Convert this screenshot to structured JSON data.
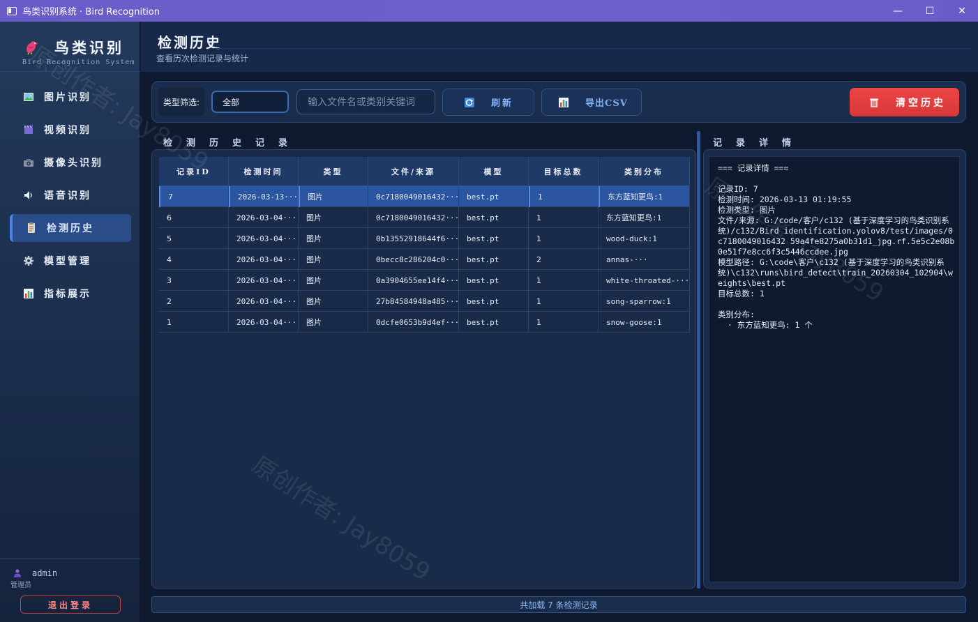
{
  "window": {
    "title": "鸟类识别系统 · Bird Recognition",
    "minimize": "—",
    "maximize": "☐",
    "close": "✕"
  },
  "sidebar": {
    "brand_title": "鸟类识别",
    "brand_subtitle": "Bird Recognition System",
    "items": [
      {
        "label": "图片识别",
        "icon": "image-icon"
      },
      {
        "label": "视频识别",
        "icon": "video-icon"
      },
      {
        "label": "摄像头识别",
        "icon": "camera-icon"
      },
      {
        "label": "语音识别",
        "icon": "speaker-icon"
      },
      {
        "label": "检测历史",
        "icon": "document-icon",
        "active": true
      },
      {
        "label": "模型管理",
        "icon": "gear-icon"
      },
      {
        "label": "指标展示",
        "icon": "chart-icon"
      }
    ],
    "user_name": "admin",
    "user_role": "管理员",
    "logout": "退出登录"
  },
  "header": {
    "title": "检测历史",
    "subtitle": "查看历次检测记录与统计"
  },
  "toolbar": {
    "filter_label": "类型筛选:",
    "filter_value": "全部",
    "search_placeholder": "输入文件名或类别关键词",
    "refresh": "刷新",
    "export": "导出CSV",
    "clear": "清空历史"
  },
  "sections": {
    "records": "检测历史记录",
    "details": "记录详情"
  },
  "table": {
    "columns": [
      "记录ID",
      "检测时间",
      "类型",
      "文件/来源",
      "模型",
      "目标总数",
      "类别分布"
    ],
    "rows": [
      [
        "7",
        "2026-03-13···",
        "图片",
        "0c7180049016432···",
        "best.pt",
        "1",
        "东方蓝知更鸟:1"
      ],
      [
        "6",
        "2026-03-04···",
        "图片",
        "0c7180049016432···",
        "best.pt",
        "1",
        "东方蓝知更鸟:1"
      ],
      [
        "5",
        "2026-03-04···",
        "图片",
        "0b13552918644f6···",
        "best.pt",
        "1",
        "wood-duck:1"
      ],
      [
        "4",
        "2026-03-04···",
        "图片",
        "0becc8c286204c0···",
        "best.pt",
        "2",
        "annas-···"
      ],
      [
        "3",
        "2026-03-04···",
        "图片",
        "0a3904655ee14f4···",
        "best.pt",
        "1",
        "white-throated-···"
      ],
      [
        "2",
        "2026-03-04···",
        "图片",
        "27b84584948a485···",
        "best.pt",
        "1",
        "song-sparrow:1"
      ],
      [
        "1",
        "2026-03-04···",
        "图片",
        "0dcfe0653b9d4ef···",
        "best.pt",
        "1",
        "snow-goose:1"
      ]
    ],
    "selected_row": 0
  },
  "detail": {
    "text": "=== 记录详情 ===\n\n记录ID: 7\n检测时间: 2026-03-13 01:19:55\n检测类型: 图片\n文件/来源: G:/code/客户/c132 (基于深度学习的鸟类识别系统)/c132/Bird identification.yolov8/test/images/0c7180049016432 59a4fe8275a0b31d1_jpg.rf.5e5c2e08b0e51f7e8cc6f3c5446ccdee.jpg\n模型路径: G:\\code\\客户\\c132 (基于深度学习的鸟类识别系统)\\c132\\runs\\bird_detect\\train_20260304_102904\\weights\\best.pt\n目标总数: 1\n\n类别分布:\n  · 东方蓝知更鸟: 1 个"
  },
  "footer": {
    "status": "共加载 7 条检测记录"
  },
  "watermark": "原创作者: Jay8059",
  "colors": {
    "accent": "#2b55a0",
    "danger": "#e04040",
    "titlebar": "#6a5cc8"
  }
}
